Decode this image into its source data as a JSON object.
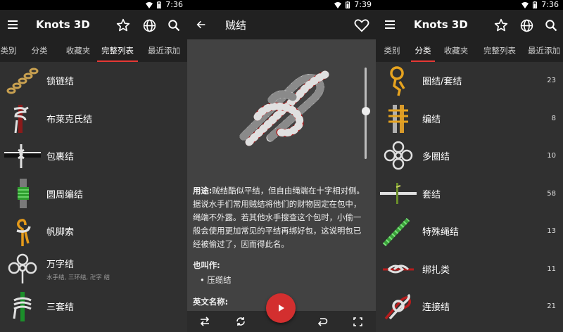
{
  "status": {
    "time": "7:36",
    "time_middle": "7:39"
  },
  "colors": {
    "accent": "#e53935",
    "fab": "#d32f2f",
    "appbar": "#212121",
    "bg_list": "#303030",
    "bg_detail": "#424242"
  },
  "left": {
    "title": "Knots 3D",
    "tabs": [
      {
        "label": "类别"
      },
      {
        "label": "分类"
      },
      {
        "label": "收藏夹"
      },
      {
        "label": "完整列表",
        "active": true
      },
      {
        "label": "最近添加"
      }
    ],
    "items": [
      {
        "label": "锁链结",
        "sub": ""
      },
      {
        "label": "布莱克氏结",
        "sub": ""
      },
      {
        "label": "包裹结",
        "sub": ""
      },
      {
        "label": "圆周编结",
        "sub": ""
      },
      {
        "label": "帆脚索",
        "sub": ""
      },
      {
        "label": "万字结",
        "sub": "水手结, 三环结, 卍字 结"
      },
      {
        "label": "三套结",
        "sub": ""
      }
    ]
  },
  "middle": {
    "title": "贼结",
    "usage_label": "用途:",
    "usage_text": "贼结酷似平结，但自由绳端在十字相对侧。据说水手们常用贼结将他们的财物固定在包中，绳端不外露。若其他水手搜查这个包时，小偷一般会使用更加常见的平结再绑好包，这说明包已经被偷过了，因而得此名。",
    "aka_label": "也叫作:",
    "aka_items": [
      "• 压缆结"
    ],
    "english_label": "英文名称:"
  },
  "right": {
    "title": "Knots 3D",
    "tabs": [
      {
        "label": "类别"
      },
      {
        "label": "分类",
        "active": true
      },
      {
        "label": "收藏夹"
      },
      {
        "label": "完整列表"
      },
      {
        "label": "最近添加"
      }
    ],
    "items": [
      {
        "label": "圈结/套结",
        "count": "23"
      },
      {
        "label": "编结",
        "count": "8"
      },
      {
        "label": "多圈结",
        "count": "10"
      },
      {
        "label": "套结",
        "count": "58"
      },
      {
        "label": "特殊绳结",
        "count": "13"
      },
      {
        "label": "绑扎类",
        "count": "11"
      },
      {
        "label": "连接结",
        "count": "21"
      }
    ]
  }
}
